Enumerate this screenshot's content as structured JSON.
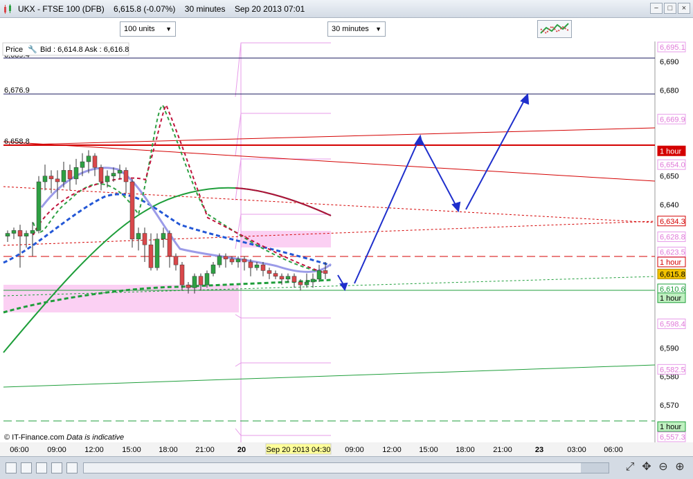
{
  "window": {
    "instrument": "UKX - FTSE 100 (DFB)",
    "price_change": "6,615.8 (-0.07%)",
    "interval": "30 minutes",
    "datetime": "Sep 20 2013 07:01",
    "controls": [
      "−",
      "□",
      "×"
    ]
  },
  "toolbar": {
    "units_label": "100 units",
    "interval_label": "30 minutes"
  },
  "chart_header": {
    "price_label": "Price",
    "bid_ask": "Bid : 6,614.8 Ask : 6,616.8"
  },
  "footer": {
    "copyright": "© IT-Finance.com",
    "disclaimer": "Data is indicative"
  },
  "colors": {
    "background": "#ffffff",
    "up_candle": "#2ea043",
    "down_candle": "#d9484b",
    "trendline_red": "#d40000",
    "ma_green": "#1e9e3a",
    "ma_dark_red": "#b0103a",
    "ma_blue_dashed": "#2357d6",
    "ma_lavender": "#9b9be8",
    "projection_arrows": "#1f2fcc",
    "pivot_pink": "#e79be9",
    "current_price_label": "#f2c200"
  },
  "chart_data": {
    "type": "candlestick",
    "ylim": [
      6557,
      6697
    ],
    "y_ticks": [
      6690,
      6680,
      6650,
      6640,
      6590,
      6580,
      6570
    ],
    "x_ticks": [
      "06:00",
      "09:00",
      "12:00",
      "15:00",
      "18:00",
      "21:00",
      "20",
      "Sep 20 2013 04:30",
      "09:00",
      "12:00",
      "15:00",
      "18:00",
      "21:00",
      "23",
      "03:00",
      "06:00"
    ],
    "horizontal_levels": [
      {
        "label": "6,689.4",
        "value": 6689.4
      },
      {
        "label": "6,676.9",
        "value": 6676.9
      },
      {
        "label": "6,658.8",
        "value": 6658.8
      }
    ],
    "right_labels": [
      {
        "text": "6,695.1",
        "value": 6695.1,
        "style": "pink"
      },
      {
        "text": "6,669.9",
        "value": 6669.9,
        "style": "pink"
      },
      {
        "text": "1 hour",
        "value": 6658.8,
        "style": "red"
      },
      {
        "text": "6,654.0",
        "value": 6654.0,
        "style": "pink"
      },
      {
        "text": "6,634.3",
        "value": 6634.3,
        "style": "red-outline"
      },
      {
        "text": "6,628.8",
        "value": 6628.8,
        "style": "pink"
      },
      {
        "text": "6,623.5",
        "value": 6623.5,
        "style": "pink"
      },
      {
        "text": "1 hour",
        "value": 6620.0,
        "style": "red-outline"
      },
      {
        "text": "6,615.8",
        "value": 6615.8,
        "style": "current"
      },
      {
        "text": "6,610.6",
        "value": 6610.6,
        "style": "green-outline"
      },
      {
        "text": "1 hour",
        "value": 6607.5,
        "style": "green"
      },
      {
        "text": "6,598.4",
        "value": 6598.4,
        "style": "pink"
      },
      {
        "text": "6,582.5",
        "value": 6582.5,
        "style": "pink"
      },
      {
        "text": "1 hour",
        "value": 6562.5,
        "style": "green"
      },
      {
        "text": "6,557.3",
        "value": 6557.3,
        "style": "pink"
      }
    ],
    "candles": [
      {
        "o": 6629,
        "h": 6631,
        "c": 6630,
        "l": 6627
      },
      {
        "o": 6630,
        "h": 6632,
        "c": 6631,
        "l": 6628
      },
      {
        "o": 6631,
        "h": 6633,
        "c": 6629,
        "l": 6618
      },
      {
        "o": 6629,
        "h": 6631,
        "c": 6630,
        "l": 6625
      },
      {
        "o": 6630,
        "h": 6634,
        "c": 6631,
        "l": 6622
      },
      {
        "o": 6631,
        "h": 6650,
        "c": 6648,
        "l": 6630
      },
      {
        "o": 6648,
        "h": 6654,
        "c": 6650,
        "l": 6645
      },
      {
        "o": 6650,
        "h": 6652,
        "c": 6649,
        "l": 6644
      },
      {
        "o": 6649,
        "h": 6652,
        "c": 6648,
        "l": 6642
      },
      {
        "o": 6648,
        "h": 6655,
        "c": 6652,
        "l": 6646
      },
      {
        "o": 6652,
        "h": 6654,
        "c": 6649,
        "l": 6645
      },
      {
        "o": 6649,
        "h": 6656,
        "c": 6653,
        "l": 6647
      },
      {
        "o": 6653,
        "h": 6658,
        "c": 6655,
        "l": 6650
      },
      {
        "o": 6655,
        "h": 6659,
        "c": 6657,
        "l": 6651
      },
      {
        "o": 6657,
        "h": 6658,
        "c": 6653,
        "l": 6650
      },
      {
        "o": 6653,
        "h": 6654,
        "c": 6648,
        "l": 6645
      },
      {
        "o": 6648,
        "h": 6652,
        "c": 6650,
        "l": 6646
      },
      {
        "o": 6650,
        "h": 6653,
        "c": 6651,
        "l": 6648
      },
      {
        "o": 6651,
        "h": 6654,
        "c": 6652,
        "l": 6649
      },
      {
        "o": 6652,
        "h": 6653,
        "c": 6648,
        "l": 6644
      },
      {
        "o": 6648,
        "h": 6649,
        "c": 6628,
        "l": 6625
      },
      {
        "o": 6628,
        "h": 6632,
        "c": 6630,
        "l": 6624
      },
      {
        "o": 6630,
        "h": 6632,
        "c": 6626,
        "l": 6620
      },
      {
        "o": 6626,
        "h": 6630,
        "c": 6618,
        "l": 6617
      },
      {
        "o": 6618,
        "h": 6630,
        "c": 6628,
        "l": 6617
      },
      {
        "o": 6628,
        "h": 6632,
        "c": 6630,
        "l": 6625
      },
      {
        "o": 6630,
        "h": 6631,
        "c": 6622,
        "l": 6618
      },
      {
        "o": 6622,
        "h": 6623,
        "c": 6619,
        "l": 6617
      },
      {
        "o": 6619,
        "h": 6620,
        "c": 6612,
        "l": 6610
      },
      {
        "o": 6612,
        "h": 6613,
        "c": 6611,
        "l": 6609
      },
      {
        "o": 6611,
        "h": 6616,
        "c": 6615,
        "l": 6609
      },
      {
        "o": 6615,
        "h": 6616,
        "c": 6612,
        "l": 6610
      },
      {
        "o": 6612,
        "h": 6617,
        "c": 6616,
        "l": 6611
      },
      {
        "o": 6616,
        "h": 6620,
        "c": 6619,
        "l": 6615
      },
      {
        "o": 6619,
        "h": 6623,
        "c": 6622,
        "l": 6618
      },
      {
        "o": 6622,
        "h": 6623,
        "c": 6621,
        "l": 6618
      },
      {
        "o": 6621,
        "h": 6622,
        "c": 6620,
        "l": 6619
      },
      {
        "o": 6620,
        "h": 6622,
        "c": 6621,
        "l": 6618
      },
      {
        "o": 6621,
        "h": 6622,
        "c": 6620,
        "l": 6617
      },
      {
        "o": 6620,
        "h": 6621,
        "c": 6618,
        "l": 6615
      },
      {
        "o": 6618,
        "h": 6620,
        "c": 6619,
        "l": 6617
      },
      {
        "o": 6619,
        "h": 6620,
        "c": 6617,
        "l": 6615
      },
      {
        "o": 6617,
        "h": 6618,
        "c": 6616,
        "l": 6614
      },
      {
        "o": 6616,
        "h": 6617,
        "c": 6615,
        "l": 6614
      },
      {
        "o": 6615,
        "h": 6616,
        "c": 6614,
        "l": 6612
      },
      {
        "o": 6614,
        "h": 6616,
        "c": 6615,
        "l": 6613
      },
      {
        "o": 6615,
        "h": 6616,
        "c": 6613,
        "l": 6611
      },
      {
        "o": 6613,
        "h": 6614,
        "c": 6612,
        "l": 6610
      },
      {
        "o": 6612,
        "h": 6616,
        "c": 6613,
        "l": 6611
      },
      {
        "o": 6613,
        "h": 6616,
        "c": 6614,
        "l": 6611
      },
      {
        "o": 6614,
        "h": 6619,
        "c": 6617,
        "l": 6613
      },
      {
        "o": 6617,
        "h": 6620,
        "c": 6616,
        "l": 6614
      }
    ]
  }
}
